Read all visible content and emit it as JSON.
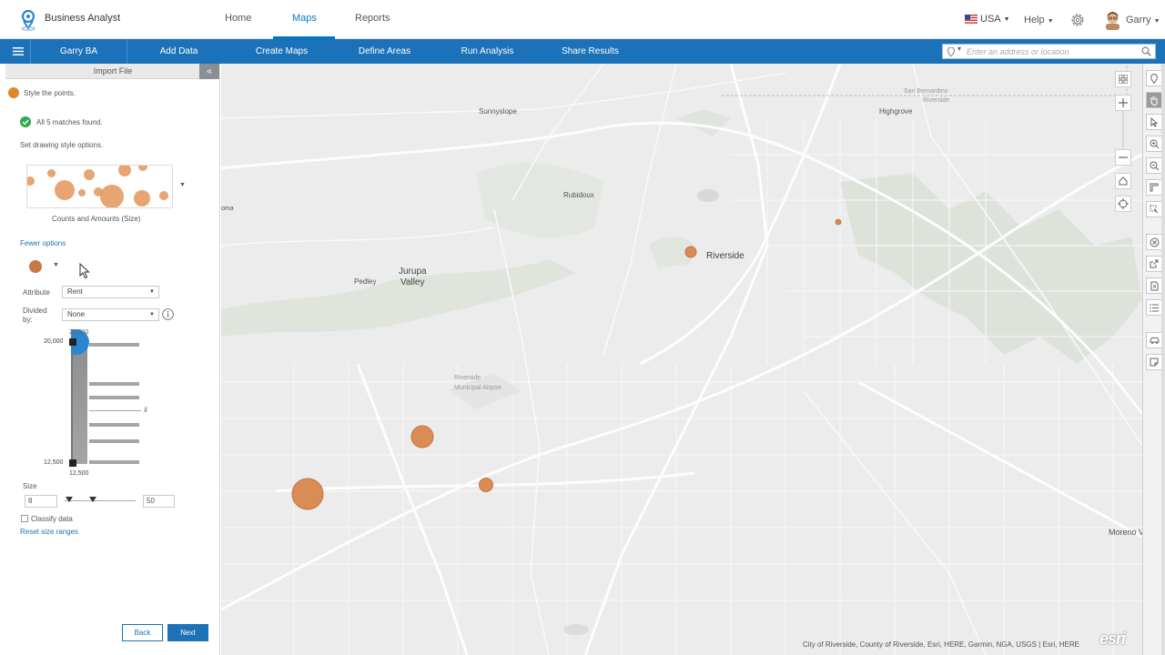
{
  "header": {
    "app_title": "Business Analyst",
    "tabs": [
      {
        "label": "Home"
      },
      {
        "label": "Maps",
        "active": true
      },
      {
        "label": "Reports"
      }
    ],
    "country": "USA",
    "help": "Help",
    "user": "Garry"
  },
  "toolbar": {
    "items": [
      "Garry BA",
      "Add Data",
      "Create Maps",
      "Define Areas",
      "Run Analysis",
      "Share Results"
    ],
    "search_placeholder": "Enter an address or location"
  },
  "panel": {
    "header": "Import File",
    "step_text": "Style the points.",
    "match_text": "All 5 matches found.",
    "style_options_label": "Set drawing style options.",
    "style_name": "Counts and Amounts (Size)",
    "fewer_options": "Fewer options",
    "attribute_label": "Attribute",
    "attribute_value": "Rent",
    "divided_label_1": "Divided",
    "divided_label_2": "by:",
    "divided_value": "None",
    "slider_top_value": "20,000",
    "slider_top_value_small": "20,000",
    "slider_bottom_value": "12,500",
    "slider_bottom_value_small": "12,500",
    "mean_symbol": "x̄",
    "size_label": "Size",
    "size_min": "8",
    "size_max": "50",
    "classify_label": "Classify data",
    "reset_link": "Reset size ranges",
    "back_label": "Back",
    "next_label": "Next"
  },
  "map": {
    "labels": {
      "sunnyslope": "Sunnyslope",
      "highgrove": "Highgrove",
      "san_bernardino": "San Bernardino",
      "riverside_small": "Riverside",
      "rubidoux": "Rubidoux",
      "riverside": "Riverside",
      "jurupa": "Jurupa",
      "valley": "Valley",
      "pedley": "Pedley",
      "airport_1": "Riverside",
      "airport_2": "Municipal Airport",
      "moreno": "Moreno Val",
      "oma": "oma"
    },
    "attribution": "City of Riverside, County of Riverside, Esri, HERE, Garmin, NGA, USGS | Esri, HERE",
    "logo_text": "esri",
    "colors": {
      "accent": "#1c72b9",
      "point": "#d9874f"
    }
  }
}
